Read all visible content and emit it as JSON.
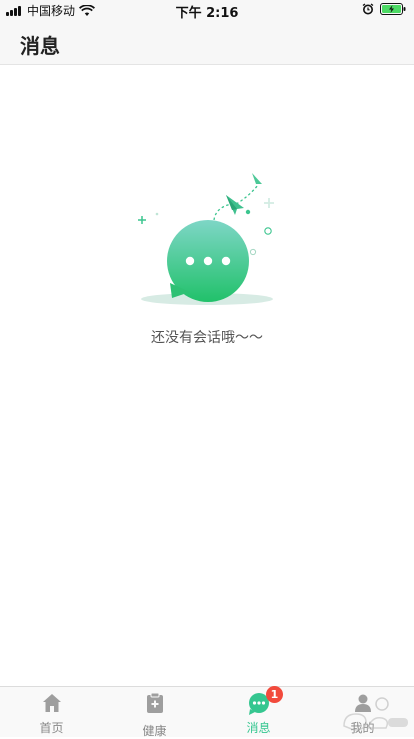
{
  "status_bar": {
    "carrier": "中国移动",
    "time": "下午 2:16"
  },
  "header": {
    "title": "消息"
  },
  "empty_state": {
    "message": "还没有会话哦～～"
  },
  "tab_bar": {
    "items": [
      {
        "label": "首页",
        "icon": "home-icon"
      },
      {
        "label": "健康",
        "icon": "health-icon"
      },
      {
        "label": "消息",
        "icon": "message-icon",
        "badge": "1",
        "active": true
      },
      {
        "label": "我的",
        "icon": "profile-icon"
      }
    ]
  },
  "colors": {
    "accent": "#35c690",
    "badge": "#f24a3c",
    "inactive": "#888888"
  }
}
